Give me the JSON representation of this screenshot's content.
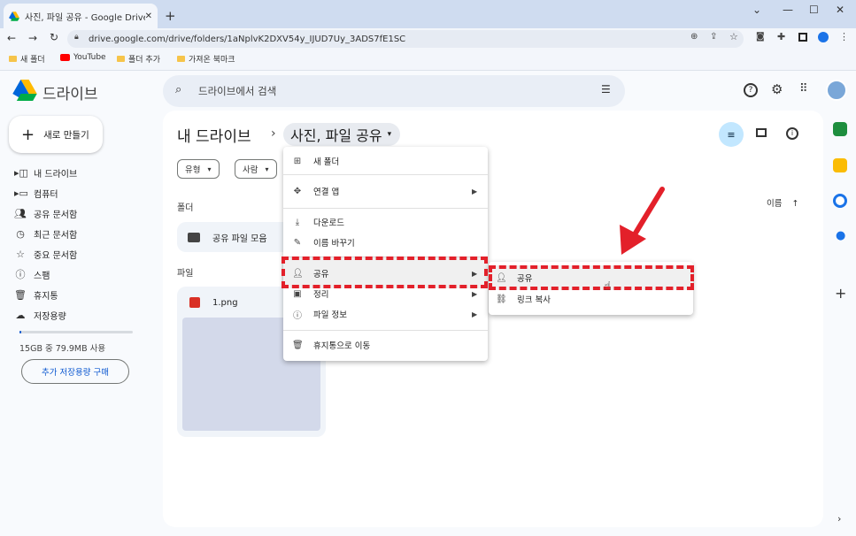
{
  "browser": {
    "tab_title": "사진, 파일 공유 - Google Drive",
    "url": "drive.google.com/drive/folders/1aNplvK2DXV54y_IJUD7Uy_3ADS7fE1SC",
    "bookmarks": [
      "새 폴더",
      "YouTube",
      "폴더 추가",
      "가져온 북마크"
    ]
  },
  "drive": {
    "app_name": "드라이브",
    "search_placeholder": "드라이브에서 검색",
    "new_button": "새로 만들기",
    "nav": [
      "내 드라이브",
      "컴퓨터",
      "공유 문서함",
      "최근 문서함",
      "중요 문서함",
      "스팸",
      "휴지통",
      "저장용량"
    ],
    "storage_text": "15GB 중 79.9MB 사용",
    "buy_storage": "추가 저장용량 구매"
  },
  "main": {
    "breadcrumb_root": "내 드라이브",
    "breadcrumb_current": "사진, 파일 공유",
    "filters": [
      "유형",
      "사람"
    ],
    "section_folders": "폴더",
    "section_files": "파일",
    "sort_label": "이름",
    "folder_name": "공유 파일 모음",
    "file_name": "1.png"
  },
  "context_menu": {
    "items": [
      "새 폴더",
      "연결 앱",
      "다운로드",
      "이름 바꾸기",
      "공유",
      "정리",
      "파일 정보",
      "휴지통으로 이동"
    ]
  },
  "submenu": {
    "items": [
      "공유",
      "링크 복사"
    ]
  },
  "colors": {
    "highlight": "#e3202a",
    "accent": "#0b57d0"
  }
}
